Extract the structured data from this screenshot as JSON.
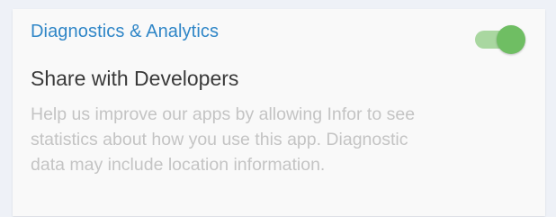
{
  "section": {
    "title": "Diagnostics & Analytics"
  },
  "setting": {
    "title": "Share with Developers",
    "description_lines": [
      "Help us improve our apps by allowing Infor to see",
      "statistics about how you use this app. Diagnostic",
      "data may include location information."
    ],
    "toggle_on": true
  },
  "colors": {
    "accent_blue": "#2f86c7",
    "toggle_thumb": "#6fbe63",
    "toggle_track": "#a9d7a0"
  }
}
